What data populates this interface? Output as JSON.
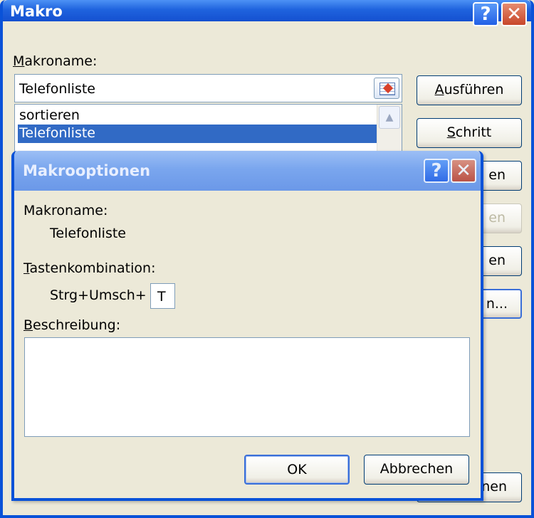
{
  "back_dialog": {
    "title": "Makro",
    "macro_name_label": "Makroname:",
    "macro_name_value": "Telefonliste",
    "list_items": [
      "sortieren",
      "Telefonliste"
    ],
    "buttons": {
      "run": "Ausführen",
      "step": "Schritt",
      "partial_1": "en",
      "partial_2": "en",
      "partial_3": "en",
      "partial_4": "n...",
      "partial_5": "nen"
    }
  },
  "front_dialog": {
    "title": "Makrooptionen",
    "macro_name_label": "Makroname:",
    "macro_name_value": "Telefonliste",
    "shortcut_label": "Tastenkombination:",
    "shortcut_prefix": "Strg+Umsch+",
    "shortcut_key": "T",
    "description_label": "Beschreibung:",
    "description_value": "",
    "ok_label": "OK",
    "cancel_label": "Abbrechen"
  },
  "colors": {
    "titlebar": "#1f63de",
    "selection": "#316ac5",
    "dialog_bg": "#ece9d8"
  }
}
